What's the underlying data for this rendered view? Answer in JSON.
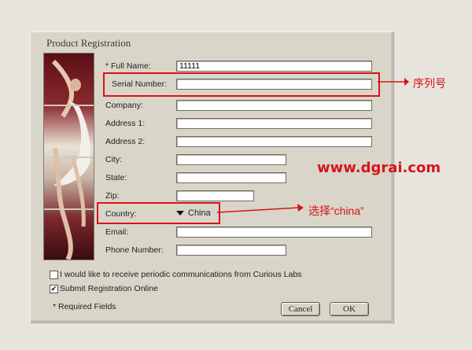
{
  "dialog": {
    "title": "Product Registration",
    "fields": {
      "full_name": {
        "label": "* Full Name:",
        "value": "11111"
      },
      "serial": {
        "label": "Serial Number:",
        "value": ""
      },
      "company": {
        "label": "Company:",
        "value": ""
      },
      "address1": {
        "label": "Address 1:",
        "value": ""
      },
      "address2": {
        "label": "Address 2:",
        "value": ""
      },
      "city": {
        "label": "City:",
        "value": ""
      },
      "state": {
        "label": "State:",
        "value": ""
      },
      "zip": {
        "label": "Zip:",
        "value": ""
      },
      "country": {
        "label": "Country:",
        "value": "China"
      },
      "email": {
        "label": "Email:",
        "value": ""
      },
      "phone": {
        "label": "Phone Number:",
        "value": ""
      }
    },
    "checkboxes": {
      "communications": {
        "label": "I would like to receive periodic communications from Curious Labs",
        "checked": false
      },
      "submit_online": {
        "label": "Submit Registration Online",
        "checked": true,
        "mark": "✔"
      }
    },
    "required_note": "* Required Fields",
    "buttons": {
      "cancel": "Cancel",
      "ok": "OK"
    }
  },
  "annotations": {
    "serial_note": "序列号",
    "country_note": "选择“china”",
    "watermark": "www.dgrai.com",
    "accent_color": "#d8141a"
  }
}
